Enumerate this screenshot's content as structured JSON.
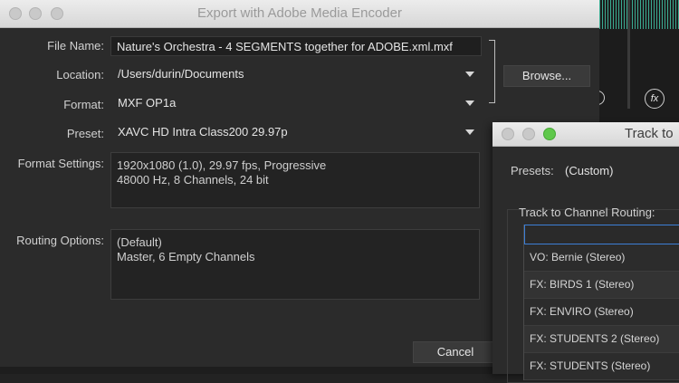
{
  "main_dialog": {
    "title": "Export with Adobe Media Encoder",
    "labels": {
      "file_name": "File Name:",
      "location": "Location:",
      "format": "Format:",
      "preset": "Preset:",
      "format_settings": "Format Settings:",
      "routing_options": "Routing Options:"
    },
    "file_name_value": "Nature's Orchestra - 4 SEGMENTS together for ADOBE.xml.mxf",
    "location_value": "/Users/durin/Documents",
    "format_value": "MXF OP1a",
    "preset_value": "XAVC HD Intra Class200 29.97p",
    "browse_label": "Browse...",
    "format_settings_lines": [
      "1920x1080 (1.0), 29.97 fps, Progressive",
      "48000 Hz, 8 Channels, 24 bit"
    ],
    "routing_lines": [
      "(Default)",
      "Master, 6 Empty Channels"
    ],
    "cancel_label": "Cancel"
  },
  "channel_dialog": {
    "title": "Track to",
    "presets_label": "Presets:",
    "presets_value": "(Custom)",
    "routing_title": "Track to Channel Routing:",
    "tracks": [
      "VO: Bernie (Stereo)",
      "FX: BIRDS 1 (Stereo)",
      "FX: ENVIRO (Stereo)",
      "FX: STUDENTS 2 (Stereo)",
      "FX: STUDENTS (Stereo)"
    ]
  },
  "background": {
    "fx_icon": "fx"
  },
  "colors": {
    "waveform": "#3fc3a5",
    "close_button_green": "#5fc84b",
    "selection_blue": "#3c7fd6"
  }
}
